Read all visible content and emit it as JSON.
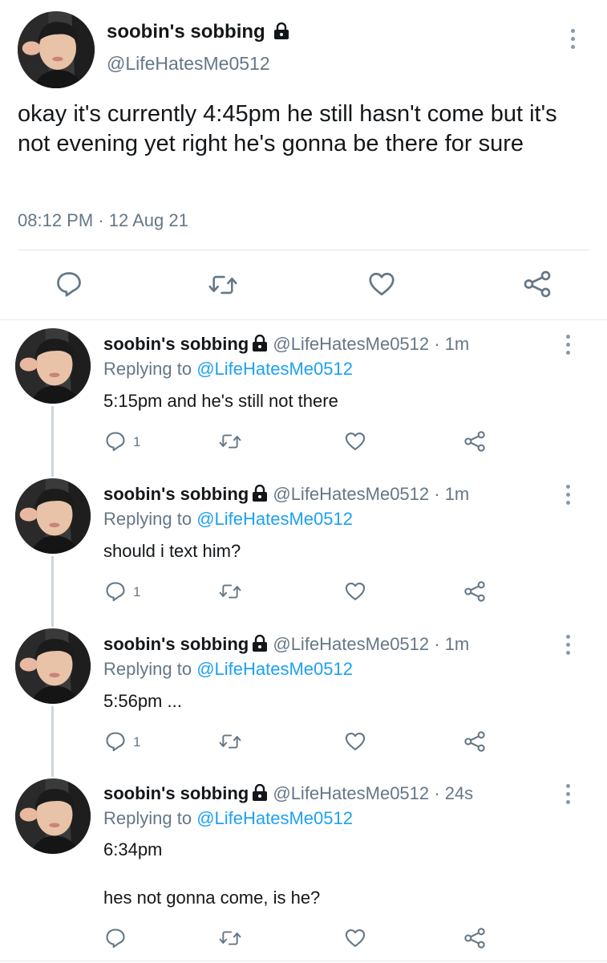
{
  "main_tweet": {
    "name": "soobin's sobbing",
    "handle": "@LifeHatesMe0512",
    "text": "okay it's currently 4:45pm he still hasn't come but it's not evening yet right he's gonna be there for sure",
    "timestamp": "08:12 PM · 12 Aug 21"
  },
  "replies": [
    {
      "name": "soobin's sobbing",
      "meta": "@LifeHatesMe0512 · 1m",
      "replying_prefix": "Replying to",
      "replying_to": "@LifeHatesMe0512",
      "text": "5:15pm and he's still not there",
      "reply_count": "1"
    },
    {
      "name": "soobin's sobbing",
      "meta": "@LifeHatesMe0512 · 1m",
      "replying_prefix": "Replying to",
      "replying_to": "@LifeHatesMe0512",
      "text": "should i text him?",
      "reply_count": "1"
    },
    {
      "name": "soobin's sobbing",
      "meta": "@LifeHatesMe0512 · 1m",
      "replying_prefix": "Replying to",
      "replying_to": "@LifeHatesMe0512",
      "text": "5:56pm ...",
      "reply_count": "1"
    },
    {
      "name": "soobin's sobbing",
      "meta": "@LifeHatesMe0512 · 24s",
      "replying_prefix": "Replying to",
      "replying_to": "@LifeHatesMe0512",
      "text": "6:34pm",
      "text2": "hes not gonna come, is he?",
      "reply_count": ""
    }
  ],
  "icons": {
    "reply": "reply-icon",
    "retweet": "retweet-icon",
    "like": "heart-icon",
    "share": "share-icon",
    "more": "more-icon",
    "lock": "lock-icon"
  },
  "colors": {
    "text": "#14171a",
    "secondary": "#657786",
    "link": "#1da1f2",
    "divider": "#e1e8ed"
  }
}
